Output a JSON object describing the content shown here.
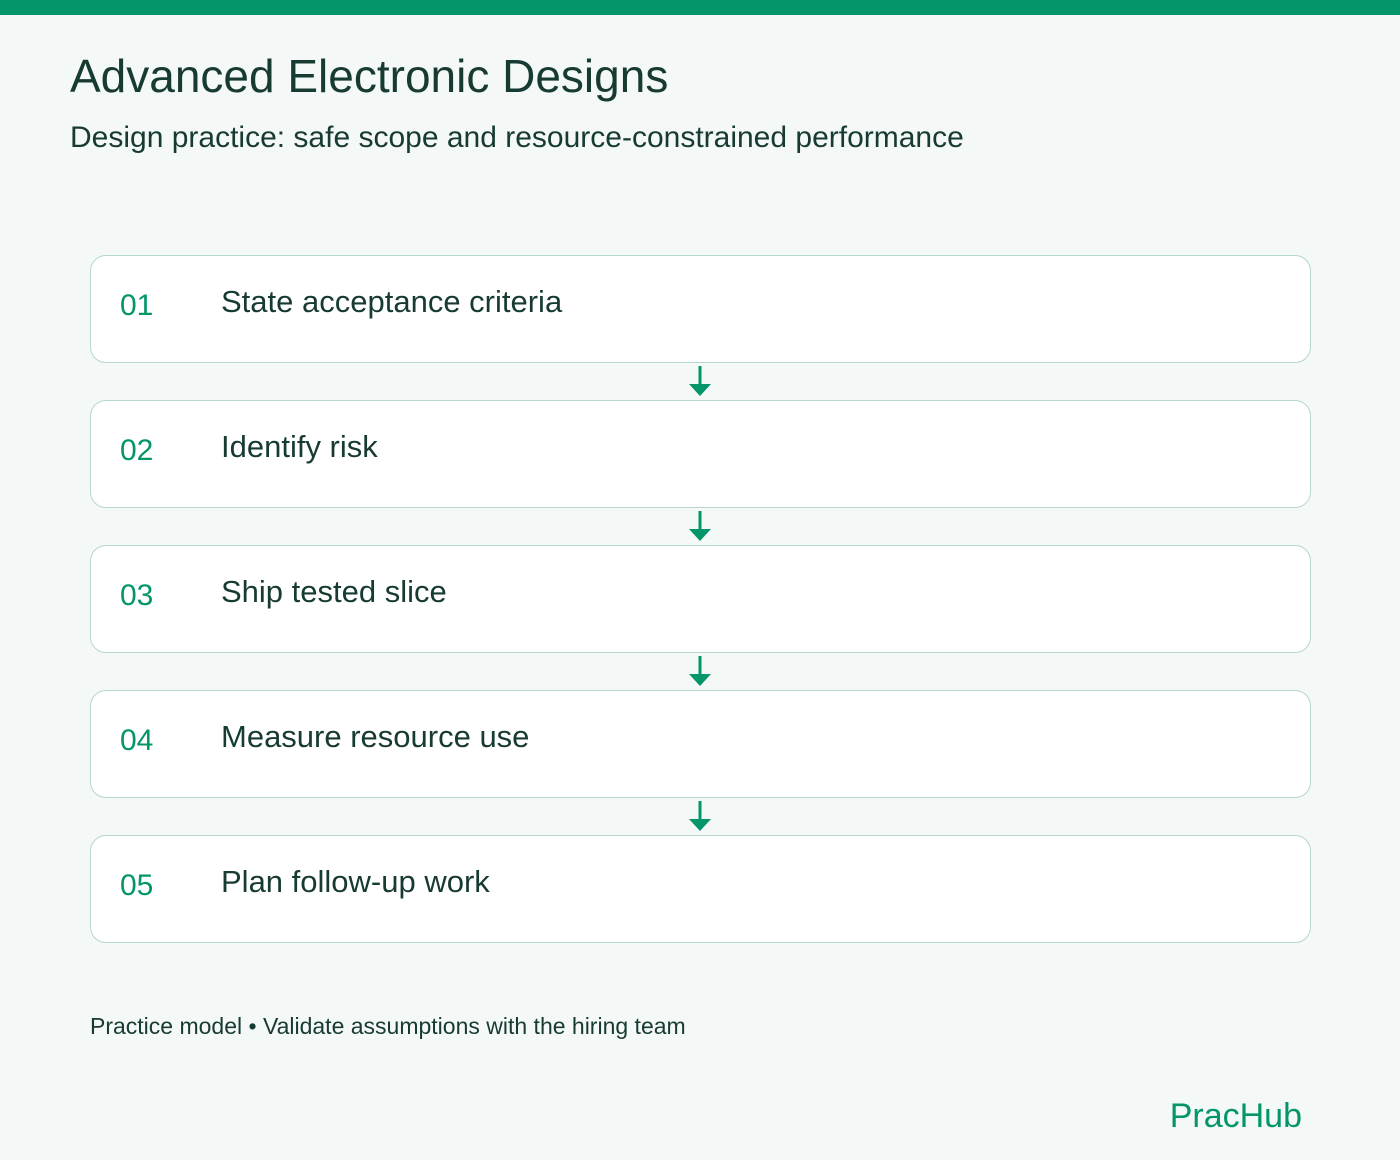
{
  "header": {
    "title": "Advanced Electronic Designs",
    "subtitle": "Design practice: safe scope and resource-constrained performance"
  },
  "steps": [
    {
      "number": "01",
      "label": "State acceptance criteria"
    },
    {
      "number": "02",
      "label": "Identify risk"
    },
    {
      "number": "03",
      "label": "Ship tested slice"
    },
    {
      "number": "04",
      "label": "Measure resource use"
    },
    {
      "number": "05",
      "label": "Plan follow-up work"
    }
  ],
  "footer": {
    "note": "Practice model • Validate assumptions with the hiring team",
    "brand": "PracHub"
  },
  "colors": {
    "accent": "#04956a",
    "text": "#173a33",
    "card_border": "#b5d7ce",
    "background": "#f4f8f7"
  },
  "icons": {
    "connector": "arrow-down-icon"
  }
}
